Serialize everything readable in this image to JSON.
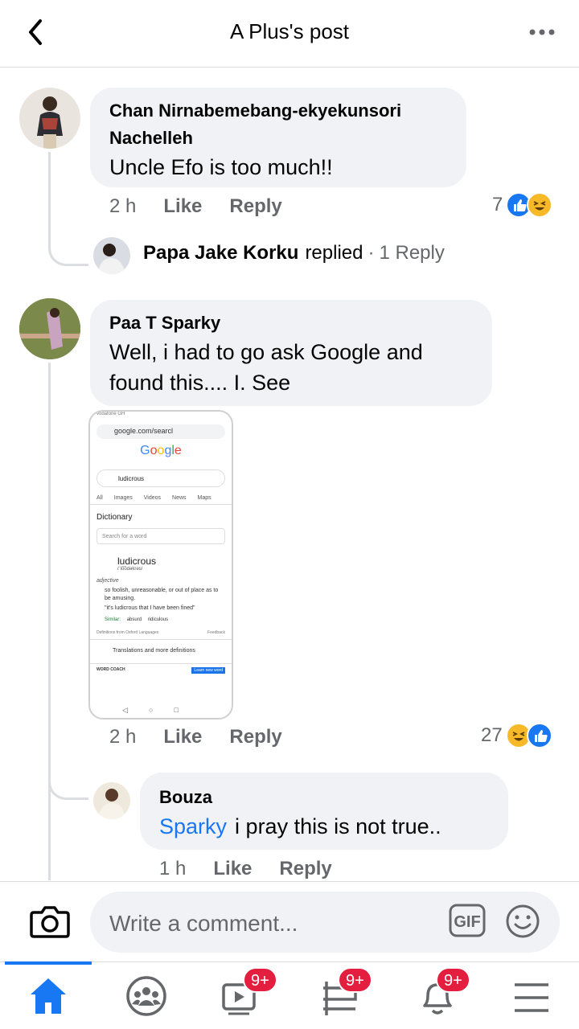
{
  "header": {
    "title": "A Plus's post"
  },
  "comments": [
    {
      "author": "Chan Nirnabemebang-ekyekunsori Nachelleh",
      "author_line1": "Chan Nirnabemebang-ekyekunsori",
      "author_line2": "Nachelleh",
      "text": "Uncle Efo is too much!!",
      "time": "2 h",
      "like": "Like",
      "reply": "Reply",
      "reaction_count": "7",
      "reactions": [
        "like",
        "haha"
      ],
      "replies_summary": {
        "name": "Papa Jake Korku",
        "action": "replied",
        "separator": "·",
        "count": "1 Reply"
      }
    },
    {
      "author": "Paa T Sparky",
      "text_line1": "Well, i had to  go ask Google and",
      "text_line2": "found this.... I. See",
      "time": "2 h",
      "like": "Like",
      "reply": "Reply",
      "reaction_count": "27",
      "reactions": [
        "haha",
        "like"
      ],
      "attachment": {
        "status_bar": "vodafone GH",
        "url": "google.com/searcl",
        "logo": "Google",
        "query": "ludicrous",
        "tabs": [
          "All",
          "Images",
          "Videos",
          "News",
          "Maps"
        ],
        "section": "Dictionary",
        "search_placeholder": "Search for a word",
        "word": "ludicrous",
        "phonetic": "/ˈlo͞odəkrəs/",
        "part_of_speech": "adjective",
        "definition": "so foolish, unreasonable, or out of place as to be amusing.",
        "example": "\"it's ludicrous that I have been fined\"",
        "similar_label": "Similar:",
        "similar": [
          "absurd",
          "ridiculous"
        ],
        "source": "Definitions from Oxford Languages",
        "feedback": "Feedback",
        "more": "Translations and more definitions",
        "coach": "WORD COACH",
        "learn": "Learn new word"
      },
      "reply_comment": {
        "author": "Bouza",
        "mention": "Sparky",
        "text": "i pray this is not true..",
        "time": "1 h",
        "like": "Like",
        "reply": "Reply"
      }
    }
  ],
  "composer": {
    "placeholder": "Write a comment...",
    "gif_label": "GIF"
  },
  "bottom_nav": {
    "items": [
      "home",
      "groups",
      "watch",
      "marketplace",
      "notifications",
      "menu"
    ],
    "badges": {
      "watch": "9+",
      "marketplace": "9+",
      "notifications": "9+"
    },
    "active": "home"
  },
  "colors": {
    "accent": "#1877f2",
    "bubble": "#f0f2f5",
    "secondary_text": "#65676b",
    "badge": "#e41e3f",
    "haha": "#f7b928"
  }
}
